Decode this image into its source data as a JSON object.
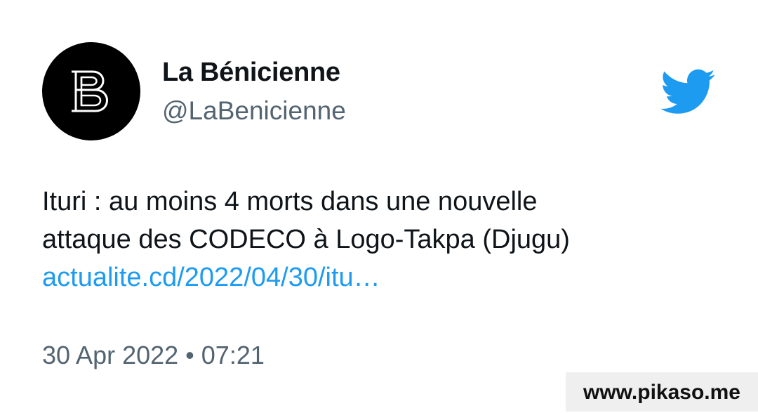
{
  "tweet": {
    "display_name": "La Bénicienne",
    "handle": "@LaBenicienne",
    "text_lines": [
      "Ituri : au moins 4 morts dans une nouvelle",
      "attaque des CODECO à Logo-Takpa (Djugu)"
    ],
    "link_text": "actualite.cd/2022/04/30/itu…",
    "timestamp": "30 Apr 2022 • 07:21"
  },
  "avatar": {
    "icon": "b-monogram-logo",
    "background": "#000000",
    "foreground": "#ffffff"
  },
  "twitter_logo": {
    "icon": "twitter-bird-icon",
    "color": "#1d9bf0"
  },
  "watermark": {
    "text": "www.pikaso.me"
  },
  "colors": {
    "text": "#0f1419",
    "secondary": "#536471",
    "link": "#1d9bf0"
  }
}
